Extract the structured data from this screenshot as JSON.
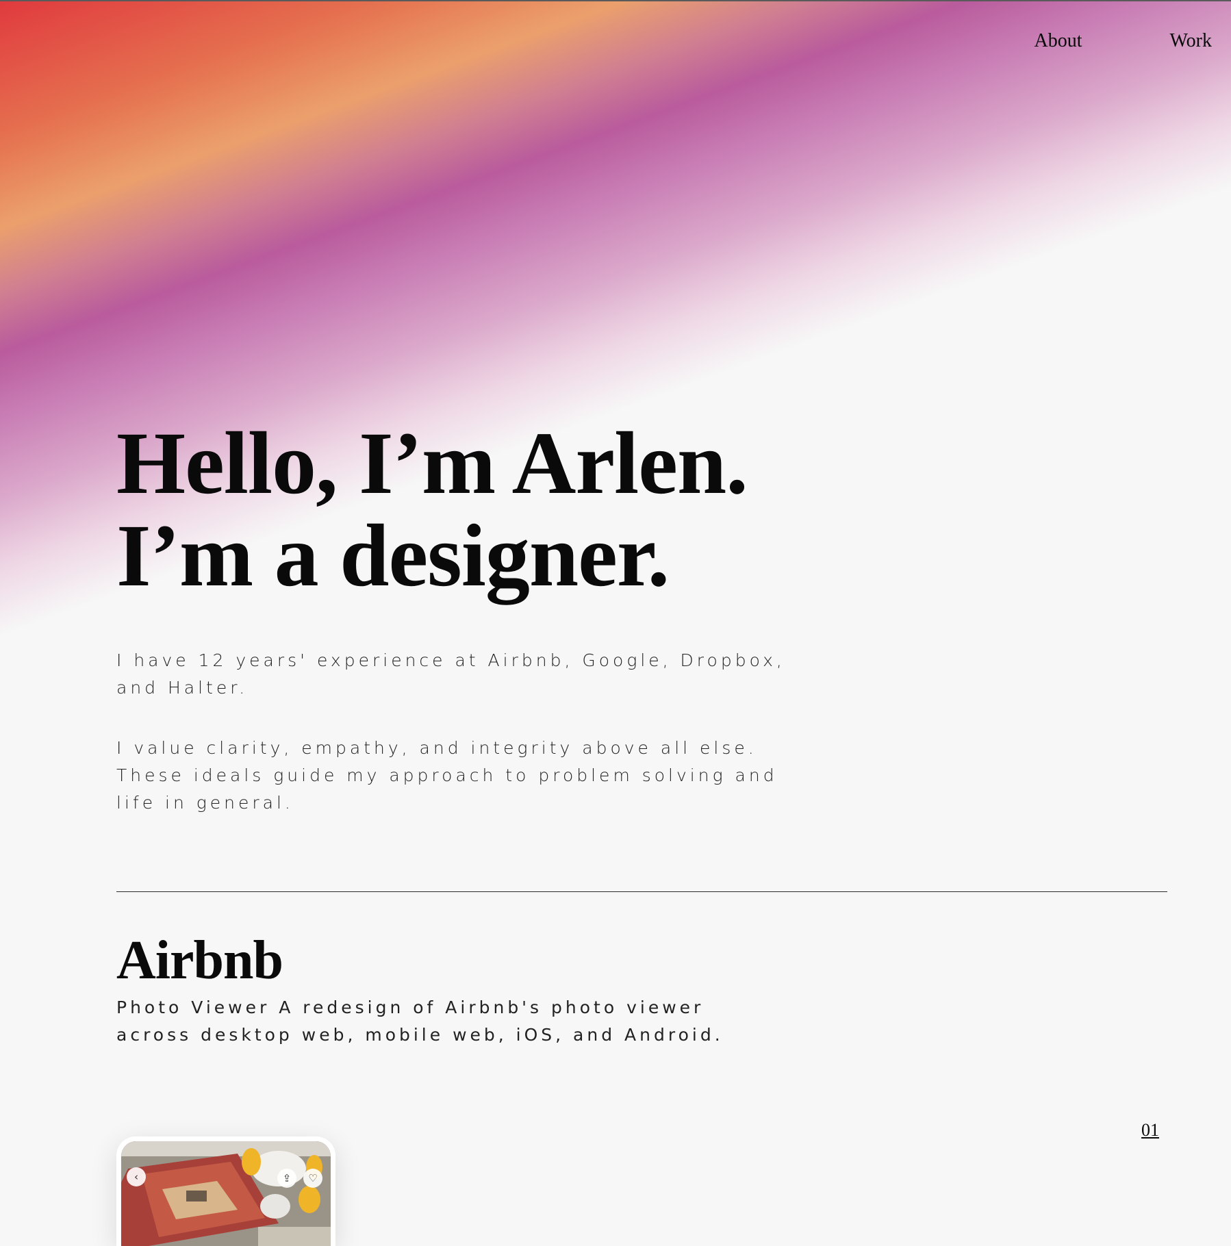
{
  "nav": {
    "about": "About",
    "work": "Work"
  },
  "hero": {
    "line1": "Hello, I’m Arlen.",
    "line2": "I’m a designer."
  },
  "intro": {
    "p1": "I have 12 years' experience at Airbnb, Google, Dropbox, and Halter.",
    "p2": "I value clarity, empathy, and integrity above all else. These ideals guide my approach to problem solving and life in general."
  },
  "project": {
    "title": "Airbnb",
    "description": "Photo Viewer A redesign of Airbnb's photo viewer across desktop web, mobile web, iOS, and Android.",
    "number": "01"
  },
  "colors": {
    "gradient": [
      "#e03a3e",
      "#eba06c",
      "#b95b9d",
      "#f7f7f7"
    ],
    "background": "#f7f7f7",
    "text": "#0a0a0a"
  },
  "icons": {
    "back": "chevron-left-icon",
    "share": "share-icon",
    "save": "heart-icon"
  }
}
